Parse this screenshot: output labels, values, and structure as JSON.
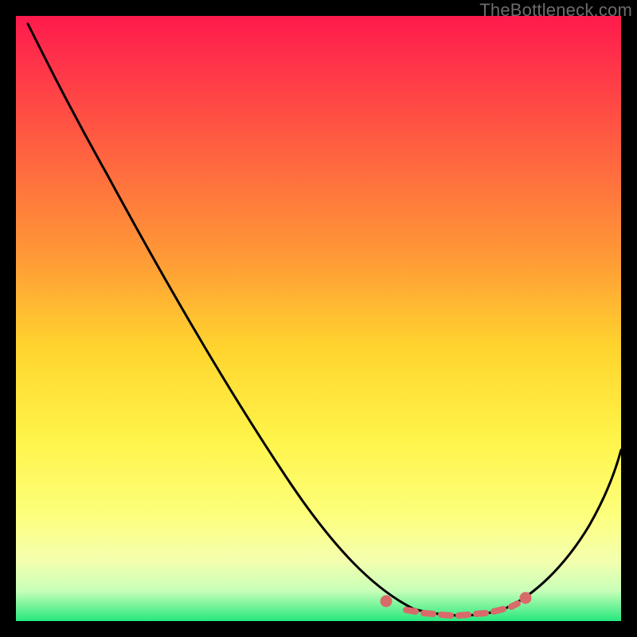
{
  "watermark": "TheBottleneck.com",
  "chart_data": {
    "type": "line",
    "title": "",
    "xlabel": "",
    "ylabel": "",
    "x": [
      0.0,
      0.05,
      0.1,
      0.15,
      0.2,
      0.25,
      0.3,
      0.35,
      0.4,
      0.45,
      0.5,
      0.55,
      0.6,
      0.65,
      0.7,
      0.75,
      0.8,
      0.85,
      0.9,
      0.95,
      1.0
    ],
    "values": [
      1.0,
      0.96,
      0.88,
      0.8,
      0.71,
      0.62,
      0.53,
      0.45,
      0.36,
      0.28,
      0.2,
      0.13,
      0.07,
      0.03,
      0.01,
      0.0,
      0.01,
      0.04,
      0.1,
      0.2,
      0.32
    ],
    "xlim": [
      0,
      1
    ],
    "ylim": [
      0,
      1
    ],
    "minimum_x": 0.75,
    "gradient": [
      "#ff1a4d",
      "#ff9a36",
      "#fff44a",
      "#26e87d"
    ],
    "marker_region": {
      "x_range": [
        0.6,
        0.85
      ],
      "style": "dashed-pink",
      "color": "#d96a6a"
    }
  }
}
